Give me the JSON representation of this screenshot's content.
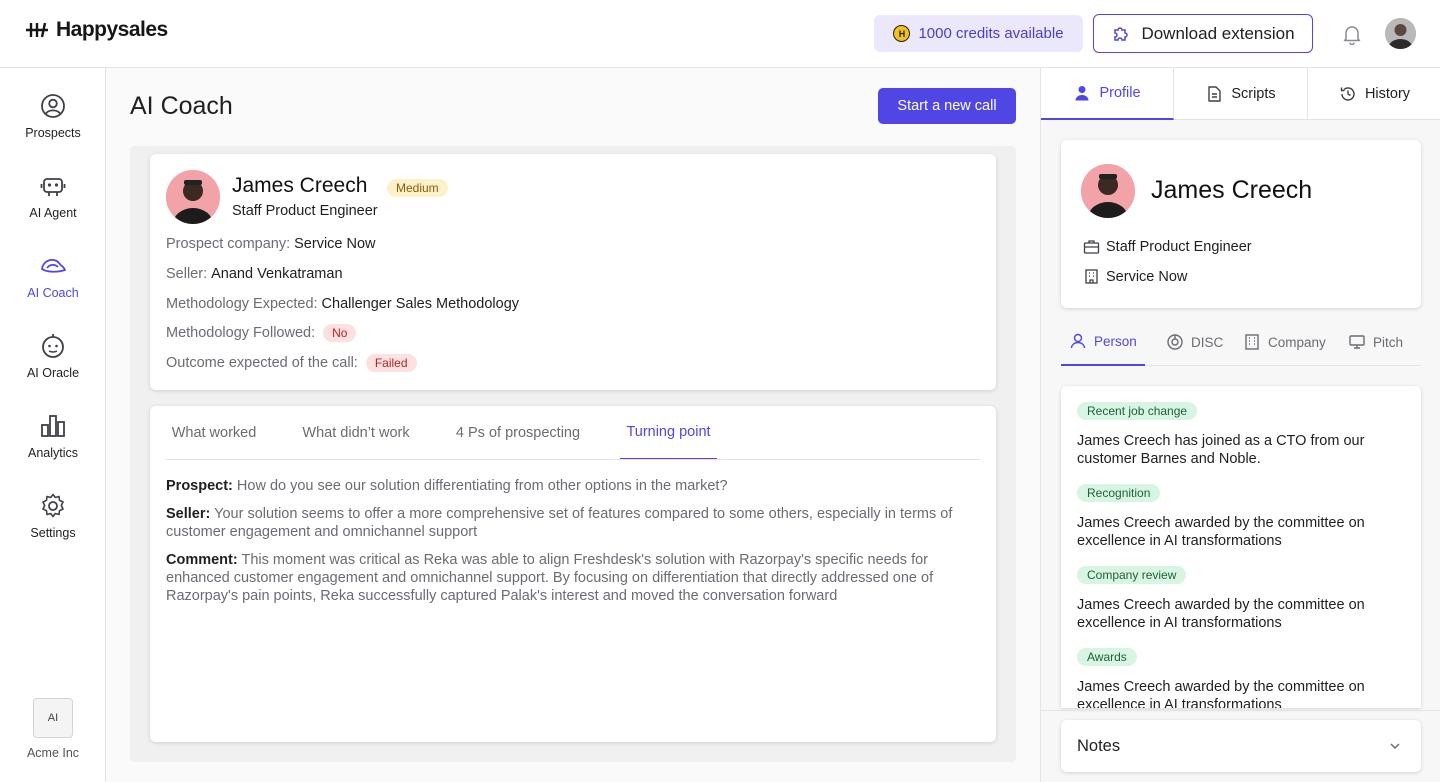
{
  "header": {
    "brand": "Happysales",
    "credits_label": "1000 credits available",
    "download_label": "Download extension"
  },
  "nav": {
    "items": [
      {
        "label": "Prospects",
        "icon": "user-circle-icon"
      },
      {
        "label": "AI Agent",
        "icon": "robot-icon"
      },
      {
        "label": "AI Coach",
        "icon": "coach-icon"
      },
      {
        "label": "AI Oracle",
        "icon": "oracle-icon"
      },
      {
        "label": "Analytics",
        "icon": "bar-chart-icon"
      },
      {
        "label": "Settings",
        "icon": "gear-icon"
      }
    ],
    "active": "AI Coach",
    "org_badge": "AI",
    "org_name": "Acme Inc"
  },
  "main": {
    "title": "AI Coach",
    "new_call_label": "Start a new call",
    "prospect": {
      "name": "James Creech",
      "priority": "Medium",
      "role": "Staff Product Engineer",
      "company_label": "Prospect company:",
      "company": "Service Now",
      "seller_label": "Seller:",
      "seller": "Anand Venkatraman",
      "method_expected_label": "Methodology Expected:",
      "method_expected": "Challenger Sales Methodology",
      "method_followed_label": "Methodology Followed:",
      "method_followed": "No",
      "outcome_label": "Outcome expected of the call:",
      "outcome": "Failed"
    },
    "tabs": [
      "What worked",
      "What didn’t work",
      "4 Ps of prospecting",
      "Turning point"
    ],
    "active_tab": "Turning point",
    "turning_point": {
      "prospect_label": "Prospect:",
      "prospect_text": "How do you see our solution differentiating from other options in the market?",
      "seller_label": "Seller:",
      "seller_text": "Your solution seems to offer a more comprehensive set of features compared to some others, especially in terms of customer engagement and omnichannel support",
      "comment_label": "Comment:",
      "comment_text": "This moment was critical as Reka was able to align Freshdesk's solution with Razorpay's specific needs for enhanced customer engagement and omnichannel support. By focusing on differentiation that directly addressed one of Razorpay's pain points, Reka successfully captured Palak's interest and moved the conversation forward"
    }
  },
  "right": {
    "tabs": [
      "Profile",
      "Scripts",
      "History"
    ],
    "active_tab": "Profile",
    "profile": {
      "name": "James Creech",
      "role": "Staff Product Engineer",
      "company": "Service Now"
    },
    "sub_tabs": [
      "Person",
      "DISC",
      "Company",
      "Pitch"
    ],
    "active_sub_tab": "Person",
    "news": [
      {
        "tag": "Recent job change",
        "text": "James Creech has joined as a CTO from our customer Barnes and Noble."
      },
      {
        "tag": "Recognition",
        "text": "James Creech awarded by the committee on excellence in AI transformations"
      },
      {
        "tag": "Company review",
        "text": "James Creech awarded by the committee on excellence in AI transformations"
      },
      {
        "tag": "Awards",
        "text": "James Creech awarded by the committee on excellence in AI transformations"
      }
    ],
    "notes_label": "Notes"
  },
  "colors": {
    "accent": "#4f46e5",
    "credits_bg": "#ebe8fb",
    "medium_badge": "#fdf1c8",
    "red_badge": "#fde1e1",
    "green_tag": "#d7f5e2"
  }
}
